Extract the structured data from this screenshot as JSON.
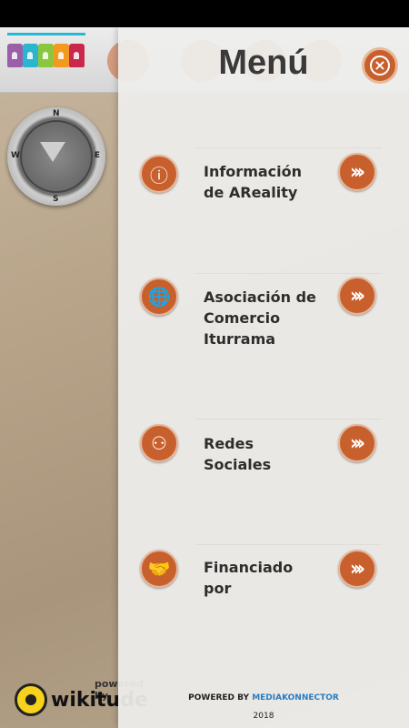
{
  "menu": {
    "title": "Menú",
    "close_icon": "close-circle-icon",
    "accent_color": "#c8602e",
    "items": [
      {
        "label": "Información\nde AReality",
        "icon": "info-person-icon",
        "go_icon": "double-chevron-right-icon"
      },
      {
        "label": "Asociación de\nComercio\nIturrama",
        "icon": "globe-hand-icon",
        "go_icon": "double-chevron-right-icon"
      },
      {
        "label": "Redes\nSociales",
        "icon": "social-network-icon",
        "go_icon": "double-chevron-right-icon"
      },
      {
        "label": "Financiado por",
        "icon": "handshake-icon",
        "go_icon": "double-chevron-right-icon"
      }
    ]
  },
  "compass": {
    "north": "N",
    "east": "E",
    "south": "S",
    "west": "W"
  },
  "wikitude": {
    "powered": "powered by",
    "brand": "wikitude"
  },
  "footer": {
    "powered_prefix": "POWERED BY",
    "powered_brand": "MEDIAKONNECTOR",
    "year": "2018"
  }
}
